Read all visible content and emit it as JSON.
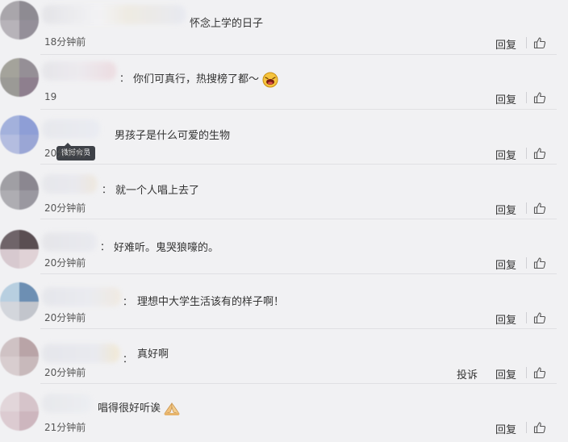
{
  "comments": [
    {
      "text": "怀念上学的日子",
      "time": "18分钟前",
      "reply": "回复",
      "colon": "",
      "emoji": ""
    },
    {
      "text": "你们可真行，热搜榜了都～",
      "time": "19",
      "reply": "回复",
      "colon": "：",
      "emoji": "laughing-emoji"
    },
    {
      "text": "男孩子是什么可爱的生物",
      "time": "20分钟前",
      "reply": "回复",
      "colon": "",
      "emoji": ""
    },
    {
      "text": "就一个人唱上去了",
      "time": "20分钟前",
      "reply": "回复",
      "colon": "：",
      "emoji": ""
    },
    {
      "text": "好难听。鬼哭狼嚎的。",
      "time": "20分钟前",
      "reply": "回复",
      "colon": "：",
      "emoji": ""
    },
    {
      "text": "理想中大学生活该有的样子啊！",
      "time": "20分钟前",
      "reply": "回复",
      "colon": "：",
      "emoji": ""
    },
    {
      "text": "真好啊",
      "time": "20分钟前",
      "reply": "回复",
      "colon": "：",
      "emoji": "",
      "report": "投诉"
    },
    {
      "text": "唱得很好听诶",
      "time": "21分钟前",
      "reply": "回复",
      "colon": "",
      "emoji": "praying-hands-emoji"
    }
  ],
  "vip_badge": "微博会员",
  "icons": {
    "like": "thumbs-up-icon"
  }
}
